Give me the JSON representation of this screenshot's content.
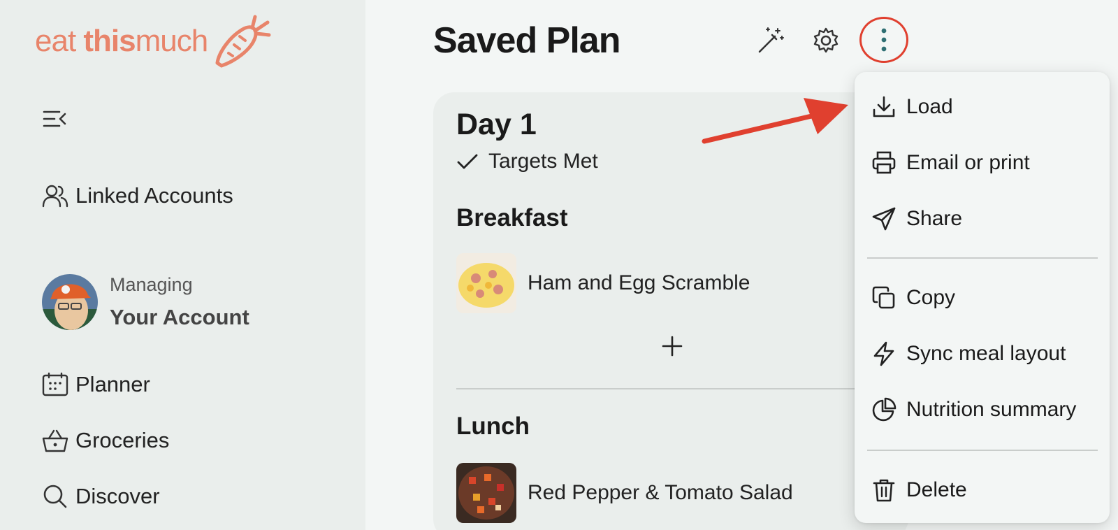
{
  "brand": {
    "logo_word1": "eat",
    "logo_word2": "this",
    "logo_word3": "much",
    "color": "#e8846a"
  },
  "sidebar": {
    "linked_accounts": "Linked Accounts",
    "managing_label": "Managing",
    "account_name": "Your Account",
    "nav": [
      {
        "label": "Planner",
        "icon": "calendar-icon"
      },
      {
        "label": "Groceries",
        "icon": "basket-icon"
      },
      {
        "label": "Discover",
        "icon": "search-icon"
      }
    ]
  },
  "header": {
    "title": "Saved Plan"
  },
  "plan": {
    "day_title": "Day 1",
    "targets_label": "Targets Met",
    "meals": [
      {
        "name": "Breakfast",
        "food": "Ham and Egg Scramble"
      },
      {
        "name": "Lunch",
        "food": "Red Pepper & Tomato Salad"
      }
    ]
  },
  "menu": {
    "items": [
      {
        "label": "Load",
        "icon": "download-icon"
      },
      {
        "label": "Email or print",
        "icon": "printer-icon"
      },
      {
        "label": "Share",
        "icon": "send-icon"
      },
      {
        "label": "Copy",
        "icon": "copy-icon"
      },
      {
        "label": "Sync meal layout",
        "icon": "lightning-icon"
      },
      {
        "label": "Nutrition summary",
        "icon": "pie-chart-icon"
      },
      {
        "label": "Delete",
        "icon": "trash-icon"
      }
    ]
  },
  "colors": {
    "highlight": "#e0402f",
    "teal_dots": "#2f6f73"
  }
}
